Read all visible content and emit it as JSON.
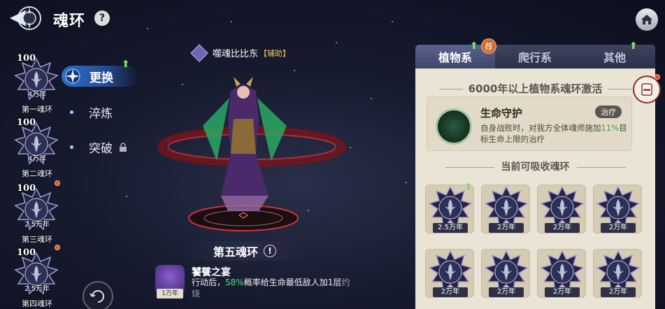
{
  "header": {
    "title": "魂环",
    "help": "?"
  },
  "left_rings": [
    {
      "level": "100",
      "age": "4万年",
      "name": "第一魂环",
      "dot": false
    },
    {
      "level": "100",
      "age": "4万年",
      "name": "第二魂环",
      "dot": false
    },
    {
      "level": "100",
      "age": "2.5万年",
      "name": "第三魂环",
      "dot": true
    },
    {
      "level": "100",
      "age": "2.5万年",
      "name": "第四魂环",
      "dot": true
    }
  ],
  "menu": {
    "active": "更换",
    "items": [
      "淬炼",
      "突破"
    ]
  },
  "character": {
    "name": "噬魂比比东",
    "role": "【辅助】"
  },
  "ring_title": "第五魂环",
  "ring_info": "!",
  "skill": {
    "name": "饕餮之宴",
    "age": "1万年",
    "desc_before": "行动后，",
    "desc_pct": "58%",
    "desc_after": "概率给生命最低敌人加1层",
    "desc_tail": "灼烧"
  },
  "panel": {
    "tabs": [
      "植物系",
      "爬行系",
      "其他"
    ],
    "active_tab": 0,
    "recommend": "荐",
    "header": "6000年以上植物系魂环激活",
    "effect": {
      "name": "生命守护",
      "tag": "治疗",
      "desc_before": "自身战败时，对我方全体魂师施加",
      "desc_pct": "11%",
      "desc_after": "目标生命上限的治疗"
    },
    "sub_header": "当前可吸收魂环",
    "rings": [
      "2.5万年",
      "2万年",
      "2万年",
      "2万年",
      "2万年",
      "2万年",
      "2万年",
      "2万年"
    ]
  },
  "colors": {
    "accent_blue": "#2f6fc8",
    "positive_green": "#54e07b",
    "panel_bg": "#eae4d6"
  }
}
